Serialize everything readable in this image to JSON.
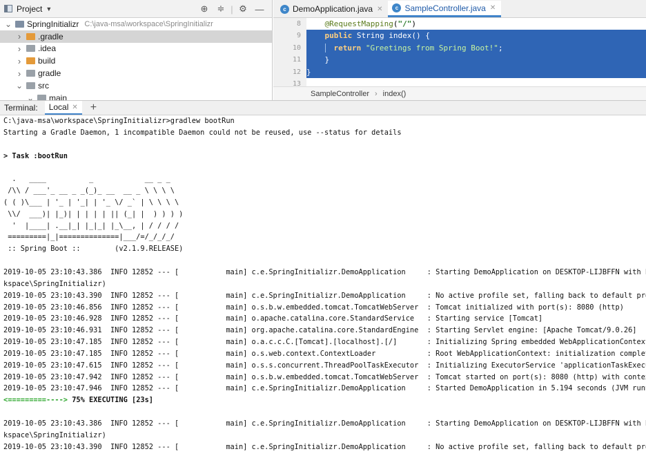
{
  "project_panel": {
    "title": "Project",
    "tree": [
      {
        "indent": 0,
        "arrow": "v",
        "icon": "folder-blue",
        "label": "SpringInitializr",
        "path": "C:\\java-msa\\workspace\\SpringInitializr"
      },
      {
        "indent": 1,
        "arrow": ">",
        "icon": "folder-orange",
        "label": ".gradle",
        "selected": true
      },
      {
        "indent": 1,
        "arrow": ">",
        "icon": "folder-grey",
        "label": ".idea"
      },
      {
        "indent": 1,
        "arrow": ">",
        "icon": "folder-orange",
        "label": "build"
      },
      {
        "indent": 1,
        "arrow": ">",
        "icon": "folder-grey",
        "label": "gradle"
      },
      {
        "indent": 1,
        "arrow": "v",
        "icon": "folder-grey",
        "label": "src"
      },
      {
        "indent": 2,
        "arrow": "v",
        "icon": "folder-grey",
        "label": "main"
      }
    ]
  },
  "editor": {
    "tabs": [
      {
        "label": "DemoApplication.java",
        "active": false
      },
      {
        "label": "SampleController.java",
        "active": true
      }
    ],
    "line_numbers": [
      "8",
      "9",
      "10",
      "11",
      "12",
      "13"
    ],
    "breadcrumbs": [
      "SampleController",
      "index()"
    ]
  },
  "terminal": {
    "label": "Terminal:",
    "tab": "Local",
    "lines": [
      {
        "text": "C:\\java-msa\\workspace\\SpringInitializr>gradlew bootRun"
      },
      {
        "text": "Starting a Gradle Daemon, 1 incompatible Daemon could not be reused, use --status for details"
      },
      {
        "text": ""
      },
      {
        "text": "> Task :bootRun",
        "bold": true
      },
      {
        "text": ""
      },
      {
        "text": "  .   ____          _            __ _ _"
      },
      {
        "text": " /\\\\ / ___'_ __ _ _(_)_ __  __ _ \\ \\ \\ \\"
      },
      {
        "text": "( ( )\\___ | '_ | '_| | '_ \\/ _` | \\ \\ \\ \\"
      },
      {
        "text": " \\\\/  ___)| |_)| | | | | || (_| |  ) ) ) )"
      },
      {
        "text": "  '  |____| .__|_| |_|_| |_\\__, | / / / /"
      },
      {
        "text": " =========|_|==============|___/=/_/_/_/"
      },
      {
        "text": " :: Spring Boot ::        (v2.1.9.RELEASE)"
      },
      {
        "text": ""
      },
      {
        "text": "2019-10-05 23:10:43.386  INFO 12852 --- [           main] c.e.SpringInitializr.DemoApplication     : Starting DemoApplication on DESKTOP-LIJBFFN with PID 12852"
      },
      {
        "text": "kspace\\SpringInitializr)"
      },
      {
        "text": "2019-10-05 23:10:43.390  INFO 12852 --- [           main] c.e.SpringInitializr.DemoApplication     : No active profile set, falling back to default profiles: d"
      },
      {
        "text": "2019-10-05 23:10:46.856  INFO 12852 --- [           main] o.s.b.w.embedded.tomcat.TomcatWebServer  : Tomcat initialized with port(s): 8080 (http)"
      },
      {
        "text": "2019-10-05 23:10:46.928  INFO 12852 --- [           main] o.apache.catalina.core.StandardService   : Starting service [Tomcat]"
      },
      {
        "text": "2019-10-05 23:10:46.931  INFO 12852 --- [           main] org.apache.catalina.core.StandardEngine  : Starting Servlet engine: [Apache Tomcat/9.0.26]"
      },
      {
        "text": "2019-10-05 23:10:47.185  INFO 12852 --- [           main] o.a.c.c.C.[Tomcat].[localhost].[/]       : Initializing Spring embedded WebApplicationContext"
      },
      {
        "text": "2019-10-05 23:10:47.185  INFO 12852 --- [           main] o.s.web.context.ContextLoader            : Root WebApplicationContext: initialization completed in 36"
      },
      {
        "text": "2019-10-05 23:10:47.615  INFO 12852 --- [           main] o.s.s.concurrent.ThreadPoolTaskExecutor  : Initializing ExecutorService 'applicationTaskExecutor'"
      },
      {
        "text": "2019-10-05 23:10:47.942  INFO 12852 --- [           main] o.s.b.w.embedded.tomcat.TomcatWebServer  : Tomcat started on port(s): 8080 (http) with context path"
      },
      {
        "text": "2019-10-05 23:10:47.946  INFO 12852 --- [           main] c.e.SpringInitializr.DemoApplication     : Started DemoApplication in 5.194 seconds (JVM running for"
      },
      {
        "progress": true,
        "bar": "<=========---->",
        "rest": " 75% EXECUTING [23s]"
      },
      {
        "text": ""
      },
      {
        "text": "2019-10-05 23:10:43.386  INFO 12852 --- [           main] c.e.SpringInitializr.DemoApplication     : Starting DemoApplication on DESKTOP-LIJBFFN with PID 12852"
      },
      {
        "text": "kspace\\SpringInitializr)"
      },
      {
        "text": "2019-10-05 23:10:43.390  INFO 12852 --- [           main] c.e.SpringInitializr.DemoApplication     : No active profile set, falling back to default profiles: d"
      }
    ]
  }
}
